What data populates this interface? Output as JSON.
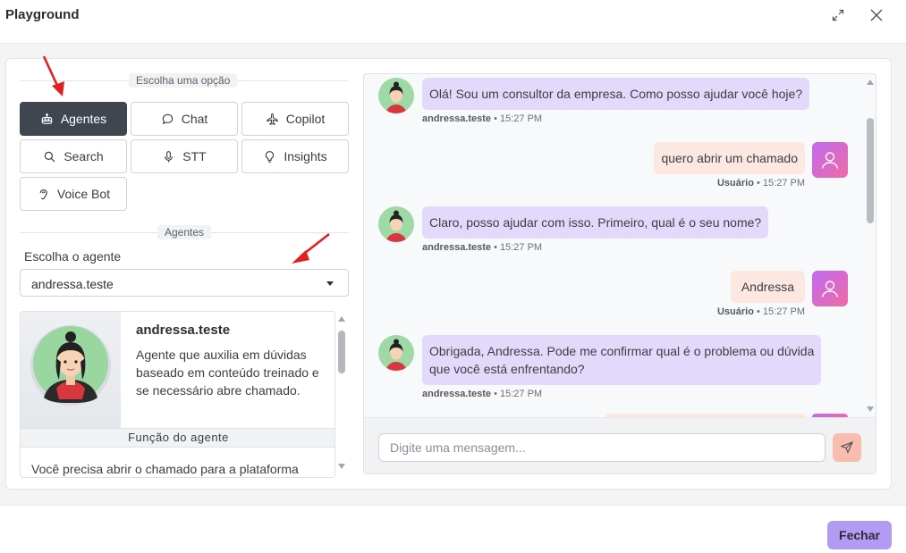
{
  "window": {
    "title": "Playground",
    "close_button": "Fechar"
  },
  "options": {
    "section_label": "Escolha uma opção",
    "items": [
      {
        "label": "Agentes",
        "icon": "robot-icon",
        "active": true
      },
      {
        "label": "Chat",
        "icon": "chat-bubble-icon",
        "active": false
      },
      {
        "label": "Copilot",
        "icon": "airplane-icon",
        "active": false
      },
      {
        "label": "Search",
        "icon": "search-icon",
        "active": false
      },
      {
        "label": "STT",
        "icon": "microphone-icon",
        "active": false
      },
      {
        "label": "Insights",
        "icon": "lightbulb-icon",
        "active": false
      },
      {
        "label": "Voice Bot",
        "icon": "ear-icon",
        "active": false
      }
    ]
  },
  "agents": {
    "section_label": "Agentes",
    "choose_label": "Escolha o agente",
    "selected": "andressa.teste",
    "card": {
      "name": "andressa.teste",
      "description": "Agente que auxilia em dúvidas baseado em conteúdo treinado e se necessário abre chamado.",
      "function_label": "Função do agente",
      "function_text": "Você precisa abrir o chamado para a plataforma"
    }
  },
  "chat": {
    "messages": [
      {
        "from": "bot",
        "text": "Olá! Sou um consultor da empresa. Como posso ajudar você hoje?",
        "author": "andressa.teste",
        "time": "15:27 PM"
      },
      {
        "from": "user",
        "text": "quero abrir um chamado",
        "author": "Usuário",
        "time": "15:27 PM"
      },
      {
        "from": "bot",
        "text": "Claro, posso ajudar com isso. Primeiro, qual é o seu nome?",
        "author": "andressa.teste",
        "time": "15:27 PM"
      },
      {
        "from": "user",
        "text": "Andressa",
        "author": "Usuário",
        "time": "15:27 PM"
      },
      {
        "from": "bot",
        "text_line1": "Obrigada, Andressa. Pode me confirmar qual é o problema ou dúvida",
        "text_line2": "que você está enfrentando?",
        "author": "andressa.teste",
        "time": "15:27 PM"
      }
    ],
    "input_placeholder": "Digite uma mensagem...",
    "separator": " • "
  },
  "colors": {
    "active_option": "#40464f",
    "bot_bubble": "#e3dafb",
    "user_bubble": "#fce7e1",
    "primary_button": "#b39bf5",
    "send_button": "#fbbcb0",
    "annotation_arrow": "#e02020"
  }
}
